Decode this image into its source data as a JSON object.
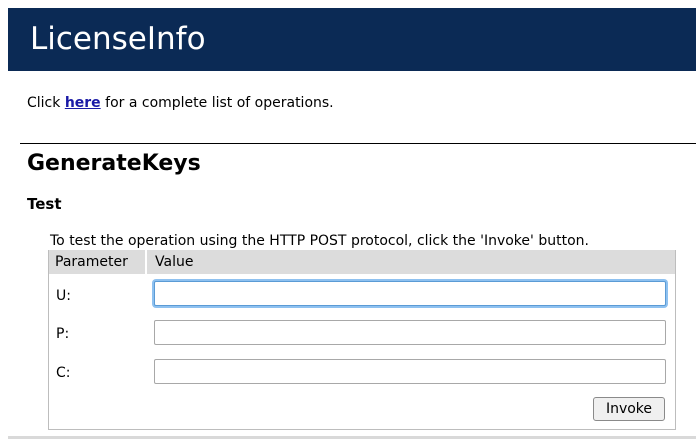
{
  "header": {
    "title": "LicenseInfo"
  },
  "intro": {
    "prefix": "Click ",
    "link_text": "here",
    "suffix": " for a complete list of operations."
  },
  "operation": {
    "name": "GenerateKeys"
  },
  "test_section": {
    "heading": "Test",
    "instructions": "To test the operation using the HTTP POST protocol, click the 'Invoke' button.",
    "columns": [
      "Parameter",
      "Value"
    ],
    "params": [
      {
        "label": "U:",
        "value": ""
      },
      {
        "label": "P:",
        "value": ""
      },
      {
        "label": "C:",
        "value": ""
      }
    ],
    "invoke_label": "Invoke"
  },
  "colors": {
    "header_bg": "#0b2a55",
    "link": "#1a1aa6",
    "table_header_bg": "#dcdcdc",
    "focus_ring": "#8ec1f0"
  }
}
